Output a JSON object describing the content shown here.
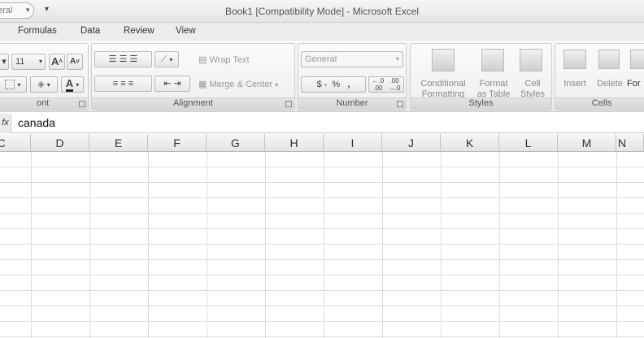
{
  "window": {
    "title": "Book1  [Compatibility Mode] - Microsoft Excel",
    "qat_combo": "eral",
    "qat_more": "▾"
  },
  "tabs": [
    "Formulas",
    "Data",
    "Review",
    "View"
  ],
  "ribbon": {
    "font": {
      "size": "11",
      "label": "ont",
      "grow_icon": "A",
      "shrink_icon": "A",
      "font_color_icon": "A"
    },
    "alignment": {
      "wrap_text": "Wrap Text",
      "merge_center": "Merge & Center",
      "label": "Alignment"
    },
    "number": {
      "format": "General",
      "currency": "$",
      "percent": "%",
      "comma": ",",
      "increase_decimal": "←.0 .00",
      "decrease_decimal": ".00 →.0",
      "label": "Number"
    },
    "styles": {
      "conditional_1": "Conditional",
      "conditional_2": "Formatting",
      "format_table_1": "Format",
      "format_table_2": "as Table",
      "cell_styles_1": "Cell",
      "cell_styles_2": "Styles",
      "label": "Styles"
    },
    "cells": {
      "insert": "Insert",
      "delete": "Delete",
      "format": "For",
      "label": "Cells"
    }
  },
  "formula_bar": {
    "fx": "fx",
    "value": "canada"
  },
  "columns": [
    "C",
    "D",
    "E",
    "F",
    "G",
    "H",
    "I",
    "J",
    "K",
    "L",
    "M",
    "N"
  ]
}
